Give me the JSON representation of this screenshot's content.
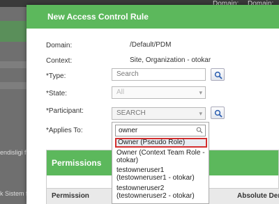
{
  "background": {
    "domain_label_1": "Domain:",
    "domain_label_2": "Domain:",
    "side_text_1": "endisligi f",
    "side_text_2": "k Sistem f"
  },
  "dialog": {
    "title": "New Access Control Rule",
    "fields": {
      "domain_label": "Domain:",
      "domain_value": "/Default/PDM",
      "context_label": "Context:",
      "context_value": "Site, Organization - otokar",
      "type_label": "*Type:",
      "type_placeholder": "Search",
      "state_label": "*State:",
      "state_value": "All",
      "participant_label": "*Participant:",
      "participant_value": "SEARCH",
      "applies_label": "*Applies To:"
    },
    "permissions": {
      "title": "Permissions",
      "columns": [
        "Permission",
        "Absolute Deny"
      ]
    }
  },
  "dropdown": {
    "query": "owner",
    "options": [
      "Owner (Pseudo Role)",
      "Owner (Context Team Role - otokar)",
      "testowneruser1 (testowneruser1 - otokar)",
      "testowneruser2 (testowneruser2 - otokar)"
    ],
    "selected_index": 0
  },
  "colors": {
    "accent": "#5cb85c",
    "selection_border": "#d32f2f"
  }
}
